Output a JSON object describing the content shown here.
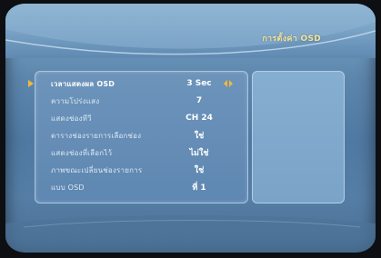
{
  "header": {
    "menu_title": "การตั้งค่า OSD"
  },
  "menu": {
    "items": [
      {
        "label": "เวลาแสดงผล OSD",
        "value": "3 Sec"
      },
      {
        "label": "ความโปร่งแสง",
        "value": "7"
      },
      {
        "label": "แสดงช่องทีวี",
        "value": "CH 24"
      },
      {
        "label": "ตารางช่องรายการเลือกช่อง",
        "value": "ใช่"
      },
      {
        "label": "แสดงช่องที่เลือกไว้",
        "value": "ไม่ใช่"
      },
      {
        "label": "ภาพขณะเปลี่ยนช่องรายการ",
        "value": "ใช่"
      },
      {
        "label": "แบบ OSD",
        "value": "ที่ 1"
      }
    ]
  },
  "colors": {
    "accent": "#f0b93a",
    "title": "#f3e39b"
  },
  "icons": {
    "selection": "right-arrow-icon",
    "adjust": "left-right-arrows-icon"
  }
}
